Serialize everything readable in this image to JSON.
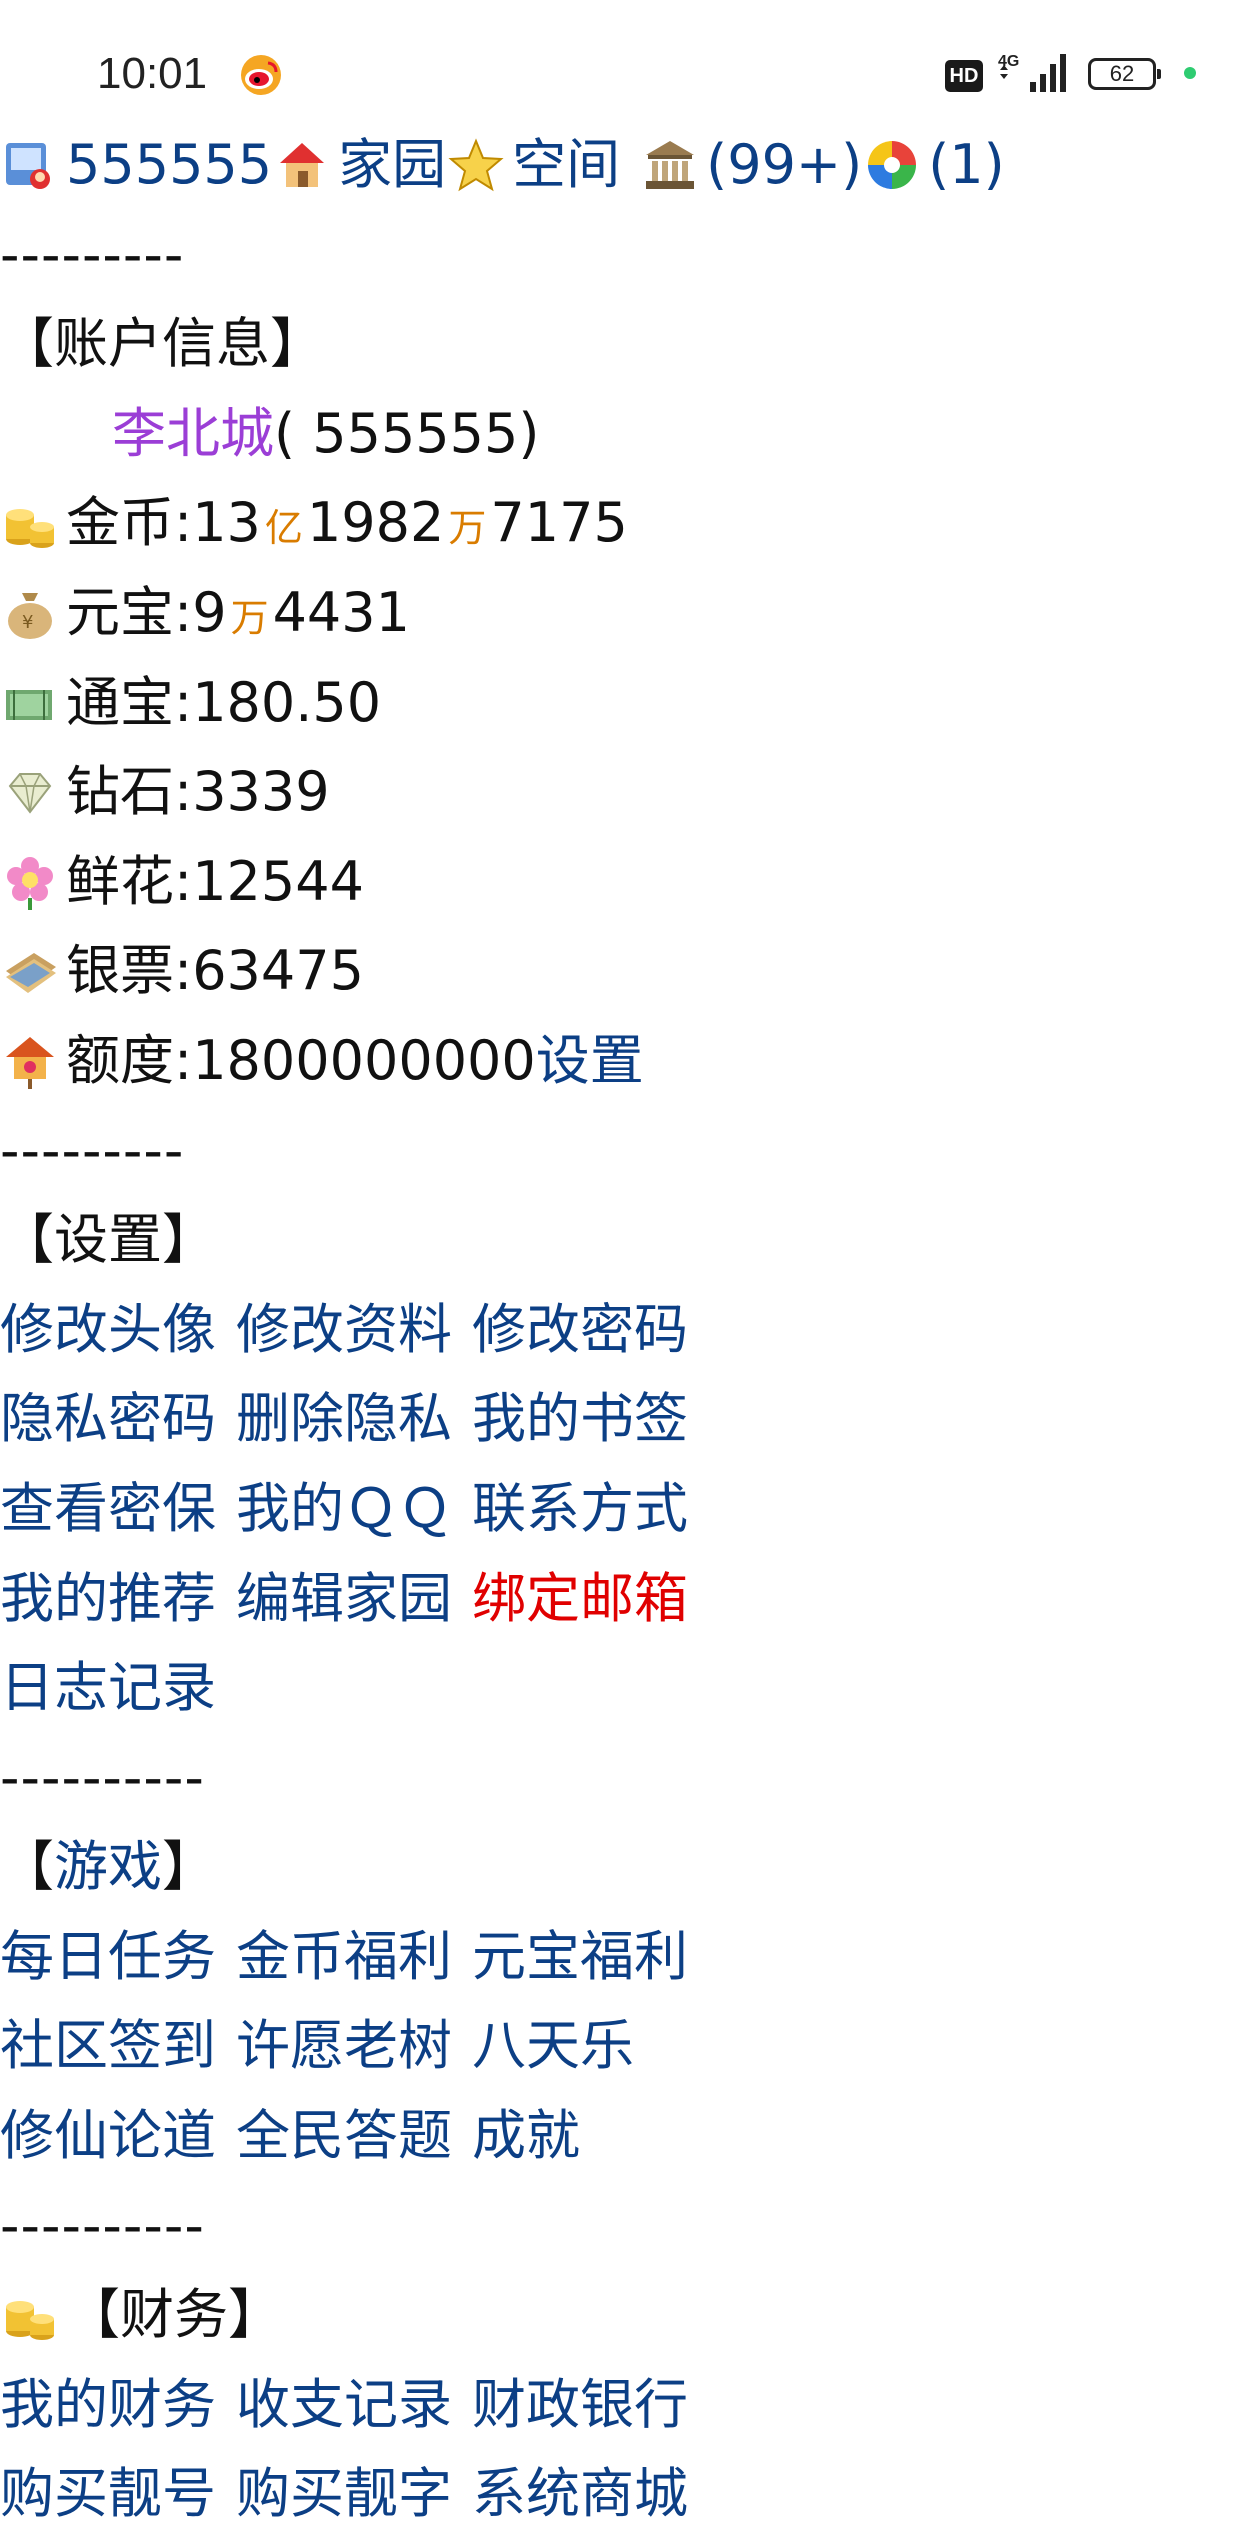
{
  "status_bar": {
    "time": "10:01",
    "hd": "HD",
    "battery": "62"
  },
  "top_nav": {
    "user_id": "555555",
    "home": "家园",
    "space": "空间",
    "messages": "(99+)",
    "notifications": "(1)"
  },
  "separators": {
    "s1": "---------",
    "s2": "---------",
    "s3": "----------",
    "s4": "----------"
  },
  "account": {
    "heading": "【账户信息】",
    "name": "李北城",
    "id_text": "( 555555)",
    "gold_label": "金币:",
    "gold_part1": "13",
    "gold_unit1": "亿",
    "gold_part2": "1982",
    "gold_unit2": "万",
    "gold_part3": "7175",
    "yuanbao_label": "元宝:",
    "yuanbao_part1": "9",
    "yuanbao_unit1": "万",
    "yuanbao_part2": "4431",
    "tongbao": "通宝:180.50",
    "diamond": "钻石:3339",
    "flower": "鲜花:12544",
    "banknote": "银票:63475",
    "quota": "额度:1800000000",
    "quota_set": "设置"
  },
  "settings": {
    "heading": "【设置】",
    "links": [
      "修改头像",
      "修改资料",
      "修改密码",
      "隐私密码",
      "删除隐私",
      "我的书签",
      "查看密保",
      "我的ＱＱ",
      "联系方式",
      "我的推荐",
      "编辑家园",
      "绑定邮箱",
      "日志记录"
    ]
  },
  "games": {
    "heading_open": "【",
    "heading_link": "游戏",
    "heading_close": "】",
    "links": [
      "每日任务",
      "金币福利",
      "元宝福利",
      "社区签到",
      "许愿老树",
      "八天乐",
      "修仙论道",
      "全民答题",
      "成就"
    ]
  },
  "finance": {
    "heading": "【财务】",
    "links": [
      "我的财务",
      "收支记录",
      "财政银行",
      "购买靓号",
      "购买靓字",
      "系统商城"
    ]
  },
  "colors": {
    "link": "#0c3f85",
    "alert": "#e00000",
    "name": "#9b3ed6",
    "unit": "#d97c00"
  }
}
